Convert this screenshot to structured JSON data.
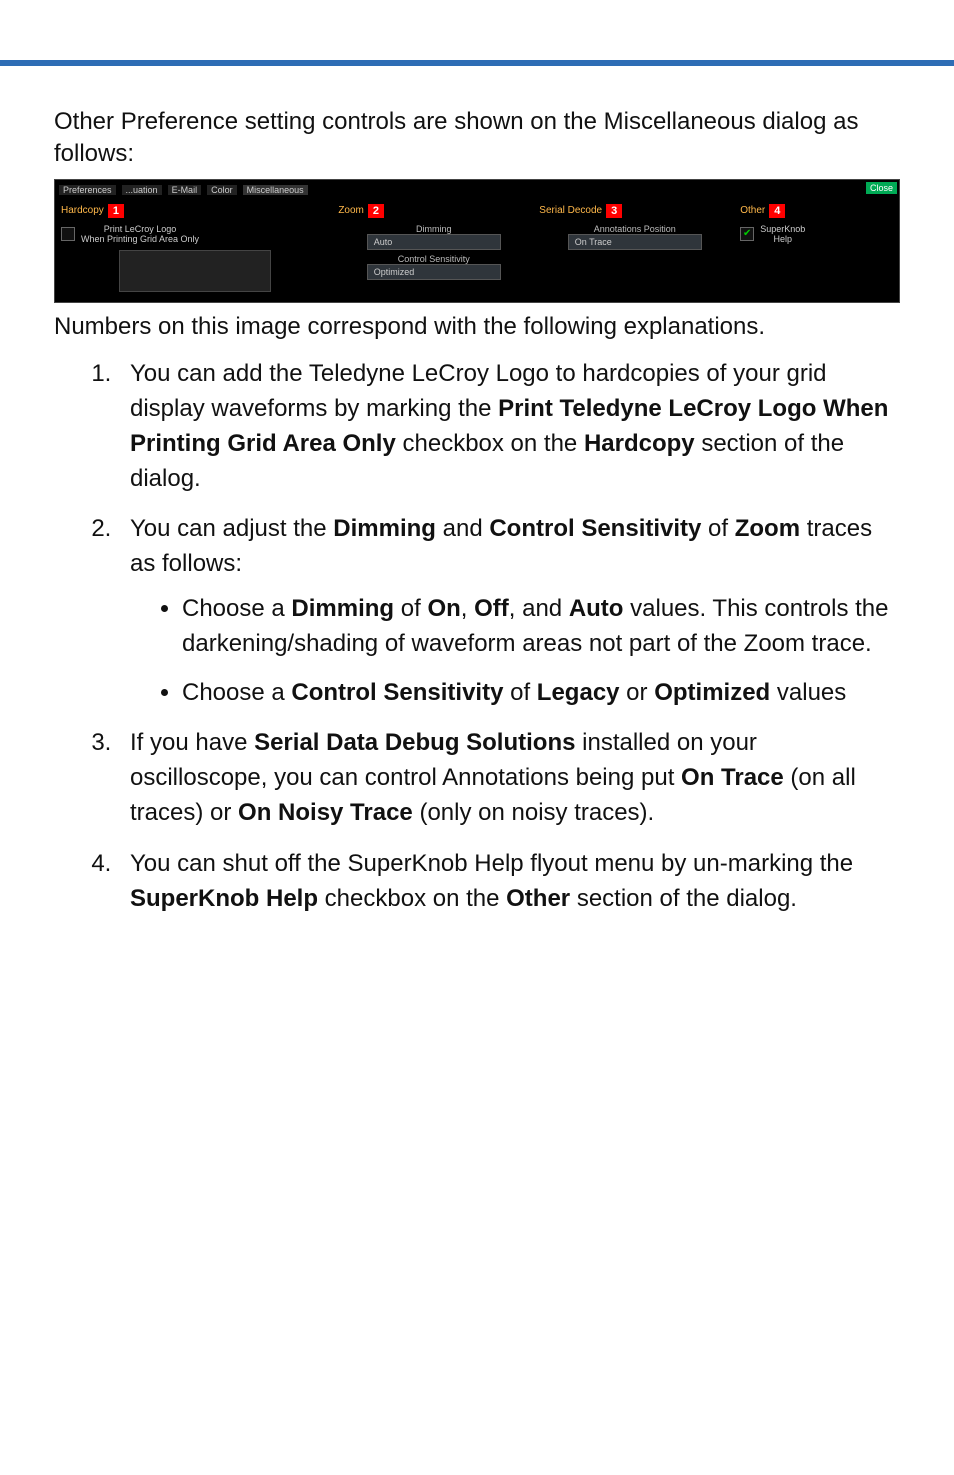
{
  "intro": "Other Preference setting controls are shown on the Miscellaneous dialog as follows:",
  "caption": "Numbers on this image correspond with the following explanations.",
  "screenshot": {
    "tabs": {
      "preferences": "Preferences",
      "uation": "...uation",
      "email": "E-Mail",
      "color": "Color",
      "misc": "Miscellaneous"
    },
    "close": "Close",
    "hardcopy": {
      "title": "Hardcopy",
      "badge": "1",
      "chk_label_line1": "Print LeCroy Logo",
      "chk_label_line2": "When Printing Grid Area Only"
    },
    "zoom": {
      "title": "Zoom",
      "badge": "2",
      "dimming_label": "Dimming",
      "dimming_value": "Auto",
      "cs_label": "Control Sensitivity",
      "cs_value": "Optimized"
    },
    "serial": {
      "title": "Serial Decode",
      "badge": "3",
      "ann_label": "Annotations Position",
      "ann_value": "On Trace"
    },
    "other": {
      "title": "Other",
      "badge": "4",
      "sk_label_line1": "SuperKnob",
      "sk_label_line2": "Help"
    }
  },
  "list": {
    "i1_a": "You can add the Teledyne LeCroy Logo to hardcopies of your grid display waveforms by marking the ",
    "i1_b1": "Print Teledyne LeCroy Logo When Printing Grid Area Only",
    "i1_c": " checkbox on the ",
    "i1_b2": "Hardcopy",
    "i1_d": " section of the dialog.",
    "i2_a": "You can adjust the ",
    "i2_b1": "Dimming",
    "i2_c": " and ",
    "i2_b2": "Control Sensitivity",
    "i2_d": " of ",
    "i2_b3": "Zoom",
    "i2_e": " traces as follows:",
    "i2_s1_a": "Choose a ",
    "i2_s1_b1": "Dimming",
    "i2_s1_c": " of ",
    "i2_s1_b2": "On",
    "i2_s1_d": ", ",
    "i2_s1_b3": "Off",
    "i2_s1_e": ", and ",
    "i2_s1_b4": "Auto",
    "i2_s1_f": " values. This controls the darkening/shading of waveform areas not part of the Zoom trace.",
    "i2_s2_a": "Choose a ",
    "i2_s2_b1": "Control Sensitivity",
    "i2_s2_c": " of ",
    "i2_s2_b2": "Legacy",
    "i2_s2_d": " or ",
    "i2_s2_b3": "Optimized",
    "i2_s2_e": " values",
    "i3_a": "If you have ",
    "i3_b1": "Serial Data Debug Solutions",
    "i3_c": " installed on your oscilloscope, you can control Annotations being put ",
    "i3_b2": "On Trace",
    "i3_d": " (on all traces) or ",
    "i3_b3": "On Noisy Trace",
    "i3_e": " (only on noisy traces).",
    "i4_a": "You can shut off the SuperKnob Help flyout menu by un-marking the ",
    "i4_b1": "SuperKnob Help",
    "i4_c": " checkbox on the ",
    "i4_b2": "Other",
    "i4_d": " section of the dialog."
  }
}
